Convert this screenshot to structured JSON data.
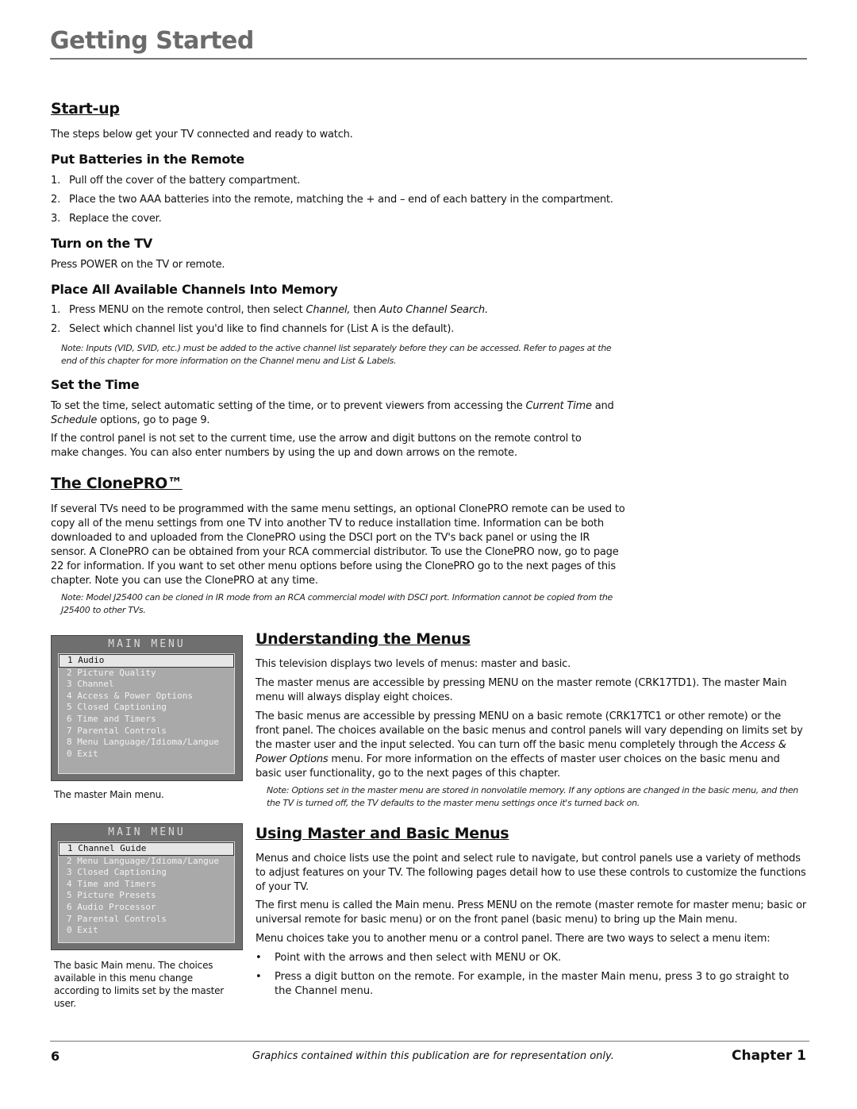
{
  "header": {
    "title": "Getting Started"
  },
  "startup": {
    "heading": "Start-up",
    "intro": "The steps below get your TV connected and ready to watch.",
    "batteries": {
      "heading": "Put Batteries in the Remote",
      "steps": [
        "Pull off the cover of the battery compartment.",
        "Place the two AAA batteries into the remote, matching the + and – end of each battery in the compartment.",
        "Replace the cover."
      ]
    },
    "turn_on": {
      "heading": "Turn on the TV",
      "text": "Press POWER on the TV or remote."
    },
    "channels": {
      "heading": "Place All Available Channels Into Memory",
      "step1_a": "Press MENU on the remote control, then select ",
      "step1_b": "Channel,",
      "step1_c": " then ",
      "step1_d": "Auto Channel Search.",
      "step2": "Select which channel list you'd like to find channels for (List A is the default).",
      "note": "Note: Inputs (VID, SVID, etc.) must be added to the active channel list separately before they can be accessed. Refer to pages at the end of this chapter for more information on the Channel menu and List & Labels."
    },
    "time": {
      "heading": "Set the Time",
      "p1_a": "To set the time, select automatic setting of the time, or to prevent viewers from accessing the ",
      "p1_b": "Current Time",
      "p1_c": " and ",
      "p1_d": "Schedule",
      "p1_e": " options, go to page 9.",
      "p2": "If the control panel is not set to the current time, use the arrow and digit buttons on the remote control to make changes. You can also enter numbers by using the up and down arrows on the remote."
    }
  },
  "clonepro": {
    "heading": "The ClonePRO™",
    "text": "If several TVs need to be programmed with the same menu settings, an optional ClonePRO remote can be used to copy all of the menu settings from one TV into another TV to reduce installation time. Information can be both downloaded to and uploaded from the ClonePRO using the DSCI port on the TV's back panel or using the IR sensor. A ClonePRO can be obtained from your RCA commercial distributor. To use the ClonePRO now, go to page 22 for information. If you want to set other menu options before using the ClonePRO go to the next pages of this chapter. Note you can use the ClonePRO at any time.",
    "note": "Note: Model J25400 can be cloned in IR mode from an RCA commercial model with DSCI port. Information cannot be copied from the J25400 to other TVs."
  },
  "master_menu": {
    "title": "MAIN MENU",
    "items": [
      "1 Audio",
      "2 Picture Quality",
      "3 Channel",
      "4 Access & Power Options",
      "5 Closed Captioning",
      "6 Time and Timers",
      "7 Parental Controls",
      "8 Menu Language/Idioma/Langue",
      "0 Exit"
    ],
    "caption": "The master Main menu."
  },
  "basic_menu": {
    "title": "MAIN MENU",
    "items": [
      "1 Channel Guide",
      "2 Menu Language/Idioma/Langue",
      "3 Closed Captioning",
      "4 Time and Timers",
      "5 Picture Presets",
      "6 Audio Processor",
      "7 Parental Controls",
      "0 Exit"
    ],
    "caption": "The basic Main menu. The choices available in this menu change according to limits set by the master user."
  },
  "understanding": {
    "heading": "Understanding the Menus",
    "p1": "This television displays two levels of menus: master and basic.",
    "p2": "The master menus are accessible by pressing MENU on the master remote (CRK17TD1). The master Main menu will always display eight choices.",
    "p3_a": "The basic menus are accessible by pressing MENU on a basic remote (CRK17TC1 or other remote) or the front panel. The choices available on the basic menus and control panels will vary depending on limits set by the master user and the input selected. You can turn off the basic menu completely through the ",
    "p3_b": "Access & Power Options",
    "p3_c": " menu. For more information on the effects of master user choices on the basic menu and basic user functionality, go to the next pages of this chapter.",
    "note": "Note: Options set in the master menu are stored in nonvolatile memory. If any options are changed in the basic menu, and then the TV is turned off, the TV defaults to the master menu settings once it's turned back on."
  },
  "using": {
    "heading": "Using Master and Basic Menus",
    "p1": "Menus and choice lists use the point and select rule to navigate, but control panels use a variety of methods to adjust features on your TV. The following pages detail how to use these controls to customize the functions of your TV.",
    "p2": "The first menu is called the Main menu. Press MENU on the remote (master remote for master menu; basic or universal remote for basic menu) or on the front panel (basic menu) to bring up the Main menu.",
    "p3": "Menu choices take you to another menu or a control panel. There are two ways to select a menu item:",
    "bullets": [
      "Point with the arrows and then select with MENU or OK.",
      "Press a digit button on the remote. For example, in the master Main menu, press 3 to go straight to the Channel menu."
    ]
  },
  "footer": {
    "page": "6",
    "note": "Graphics contained within this publication are for representation only.",
    "chapter": "Chapter 1"
  }
}
